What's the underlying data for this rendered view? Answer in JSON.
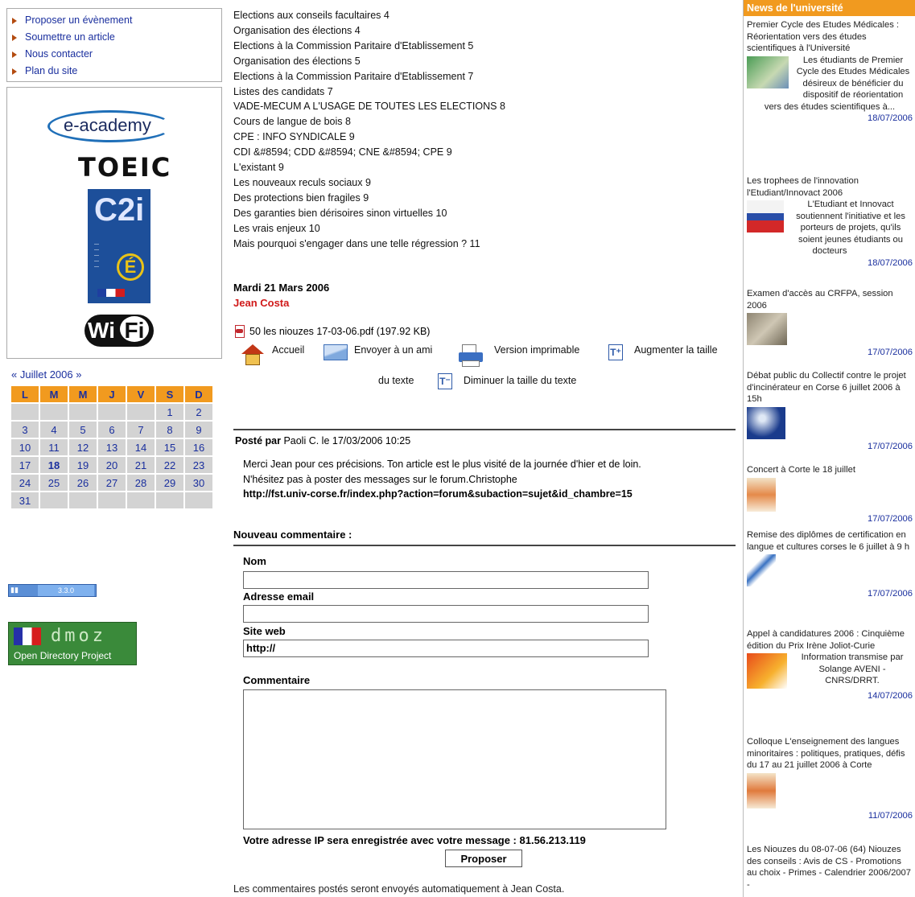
{
  "left": {
    "quicklinks": [
      "Proposer un évènement",
      "Soumettre un article",
      "Nous contacter",
      "Plan du site"
    ],
    "logos": {
      "eacademy": "e-academy",
      "toeic": "TOEIC",
      "c2i": "C2i",
      "wifi_a": "Wi",
      "wifi_b": "Fi"
    },
    "calendar": {
      "nav": "« Juillet 2006 »",
      "days": [
        "L",
        "M",
        "M",
        "J",
        "V",
        "S",
        "D"
      ],
      "weeks": [
        [
          "",
          "",
          "",
          "",
          "",
          "1",
          "2"
        ],
        [
          "3",
          "4",
          "5",
          "6",
          "7",
          "8",
          "9"
        ],
        [
          "10",
          "11",
          "12",
          "13",
          "14",
          "15",
          "16"
        ],
        [
          "17",
          "18",
          "19",
          "20",
          "21",
          "22",
          "23"
        ],
        [
          "24",
          "25",
          "26",
          "27",
          "28",
          "29",
          "30"
        ],
        [
          "31",
          "",
          "",
          "",
          "",
          "",
          ""
        ]
      ],
      "today": "18"
    },
    "version_badge": "3.3.0",
    "dmoz": {
      "letters": "dmoz",
      "label": "Open Directory Project"
    }
  },
  "main": {
    "toc": [
      "Elections aux conseils facultaires 4",
      "Organisation des élections 4",
      "Elections à la Commission Paritaire d'Etablissement 5",
      "Organisation des élections 5",
      "Elections à la Commission Paritaire d'Etablissement 7",
      "Listes des candidats 7",
      "VADE-MECUM A L'USAGE DE TOUTES LES ELECTIONS 8",
      "Cours de langue de bois 8",
      "CPE : INFO SYNDICALE 9",
      "CDI &#8594; CDD &#8594; CNE &#8594; CPE 9",
      "L'existant 9",
      "Les nouveaux reculs sociaux 9",
      "Des protections bien fragiles 9",
      "Des garanties bien dérisoires sinon virtuelles 10",
      "Les vrais enjeux 10",
      "Mais pourquoi s'engager dans une telle régression ? 11"
    ],
    "post_date": "Mardi 21 Mars 2006",
    "post_author": "Jean Costa",
    "attachment": "50 les niouzes 17-03-06.pdf  (197.92 KB)",
    "tools": {
      "home": "Accueil",
      "send": "Envoyer à un ami",
      "print": "Version imprimable",
      "increase_a": "Augmenter la taille",
      "increase_b": "du texte",
      "decrease": "Diminuer la taille du texte"
    },
    "comment": {
      "posted_by_label": "Posté par",
      "posted_by_rest": " Paoli C. le 17/03/2006 10:25",
      "line1": "Merci Jean pour ces précisions. Ton article est le plus visité de la journée d'hier et de loin.",
      "line2": "N'hésitez pas à poster des messages sur le forum.Christophe",
      "url": "http://fst.univ-corse.fr/index.php?action=forum&subaction=sujet&id_chambre=15"
    },
    "form": {
      "heading": "Nouveau commentaire :",
      "name_label": "Nom",
      "email_label": "Adresse email",
      "site_label": "Site web",
      "site_value": "http://",
      "comment_label": "Commentaire",
      "ip_note": "Votre adresse IP sera enregistrée avec votre message : 81.56.213.119",
      "submit": "Proposer",
      "footer": "Les commentaires postés seront envoyés automatiquement à Jean Costa."
    }
  },
  "right": {
    "header": "News de l'université",
    "items": [
      {
        "title": "Premier Cycle des Etudes Médicales : Réorientation vers des études scientifiques à l'Université",
        "body": "Les étudiants de Premier Cycle des Etudes Médicales désireux de bénéficier du dispositif de réorientation vers des études scientifiques à...",
        "date": "18/07/2006"
      },
      {
        "title": "Les trophees de l'innovation l'Etudiant/Innovact 2006",
        "body": "L'Etudiant et Innovact soutiennent l'initiative et les porteurs de projets, qu'ils soient jeunes étudiants ou docteurs",
        "date": "18/07/2006"
      },
      {
        "title": "Examen d'accès au CRFPA, session 2006",
        "body": "",
        "date": "17/07/2006"
      },
      {
        "title": "Débat public du Collectif contre le projet d'incinérateur en Corse 6 juillet 2006 à 15h",
        "body": "",
        "date": "17/07/2006"
      },
      {
        "title": "Concert à Corte le 18 juillet",
        "body": "",
        "date": "17/07/2006"
      },
      {
        "title": "Remise des diplômes de certification en langue et cultures corses le 6 juillet à 9 h",
        "body": "",
        "date": "17/07/2006"
      },
      {
        "title": "Appel à candidatures 2006 : Cinquième édition du Prix Irène Joliot-Curie",
        "body": "Information transmise par Solange AVENI - CNRS/DRRT.",
        "date": "14/07/2006"
      },
      {
        "title": "Colloque L'enseignement des langues minoritaires : politiques, pratiques, défis du 17 au 21 juillet 2006 à Corte",
        "body": "",
        "date": "11/07/2006"
      },
      {
        "title": "Les Niouzes du 08-07-06 (64) Niouzes des conseils : Avis de CS - Promotions au choix - Primes - Calendrier 2006/2007 -",
        "body": "",
        "date": ""
      }
    ]
  }
}
